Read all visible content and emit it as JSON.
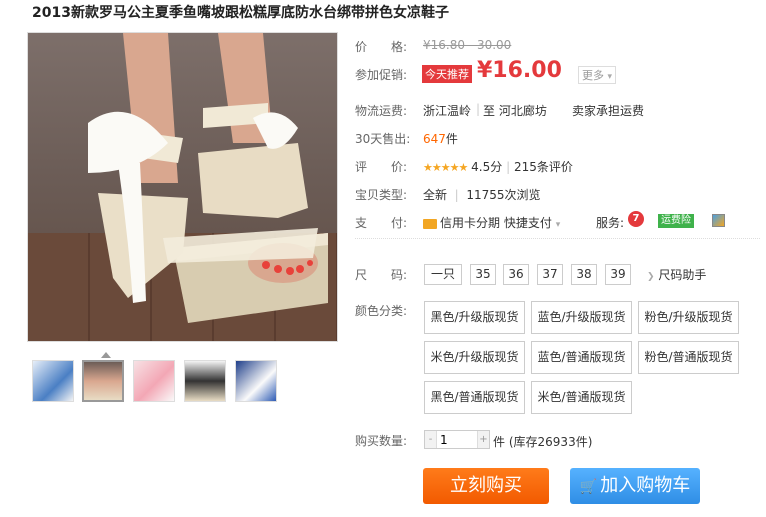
{
  "title": "2013新款罗马公主夏季鱼嘴坡跟松糕厚底防水台绑带拼色女凉鞋子",
  "price": {
    "label": "价　　格:",
    "value": "¥16.80 - 30.00"
  },
  "promo": {
    "label": "参加促销:",
    "tag": "今天推荐",
    "price": "¥16.00",
    "more": "更多"
  },
  "shipping": {
    "label": "物流运费:",
    "from": "浙江温岭",
    "to": "至  河北廊坊",
    "fee": "卖家承担运费"
  },
  "sales": {
    "label": "30天售出:",
    "count": "647",
    "unit": "件"
  },
  "rating": {
    "label": "评　　价:",
    "stars": "★★★★★",
    "score": "4.5分",
    "reviews": "215条评价"
  },
  "item_type": {
    "label": "宝贝类型:",
    "value": "全新",
    "views": "11755次浏览"
  },
  "payment": {
    "label": "支　　付:",
    "credit": "信用卡分期",
    "quick": "快捷支付",
    "service_label": "服务:",
    "service_7": "7",
    "service_ins": "运费险"
  },
  "size": {
    "label": "尺　　码:",
    "options": [
      "一只",
      "35",
      "36",
      "37",
      "38",
      "39"
    ],
    "helper": "尺码助手"
  },
  "color": {
    "label": "颜色分类:",
    "options": [
      "黑色/升级版现货",
      "蓝色/升级版现货",
      "粉色/升级版现货",
      "米色/升级版现货",
      "蓝色/普通版现货",
      "粉色/普通版现货",
      "黑色/普通版现货",
      "米色/普通版现货"
    ]
  },
  "quantity": {
    "label": "购买数量:",
    "value": "1",
    "unit": "件",
    "stock": "(库存26933件)"
  },
  "buttons": {
    "buy": "立刻购买",
    "cart": "加入购物车"
  },
  "colors": {
    "accent_red": "#e4393c",
    "buy_orange": "#f25a00",
    "cart_blue": "#2f8ee5",
    "sales_orange": "#ff6600"
  }
}
